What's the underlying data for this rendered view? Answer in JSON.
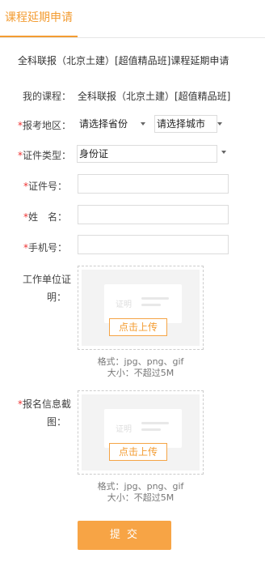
{
  "tabs": [
    {
      "label": "课程延期申请",
      "active": true
    }
  ],
  "heading": "全科联报（北京土建）[超值精品班]课程延期申请",
  "course": {
    "label": "我的课程：",
    "value": "全科联报（北京土建）[超值精品班]"
  },
  "region": {
    "required": "*",
    "label": "报考地区：",
    "province_value": "请选择省份",
    "city_value": "请选择城市"
  },
  "id_type": {
    "required": "*",
    "label": "证件类型：",
    "value": "身份证"
  },
  "id_number": {
    "required": "*",
    "label": "证件号：",
    "value": ""
  },
  "name": {
    "required": "*",
    "label": "姓　名：",
    "value": ""
  },
  "phone": {
    "required": "*",
    "label": "手机号：",
    "value": ""
  },
  "work_proof": {
    "label_line1": "工作单位证",
    "label_line2": "明：",
    "card_text": "证明",
    "button": "点击上传",
    "hint_format": "格式：jpg、png、gif",
    "hint_size": "大小：不超过5M"
  },
  "signup_proof": {
    "required": "*",
    "label_line1": "报名信息截",
    "label_line2": "图：",
    "card_text": "证明",
    "button": "点击上传",
    "hint_format": "格式：jpg、png、gif",
    "hint_size": "大小：不超过5M"
  },
  "submit_label": "提 交",
  "colors": {
    "accent": "#f39c32",
    "button": "#f7a445",
    "required": "#e33333"
  }
}
